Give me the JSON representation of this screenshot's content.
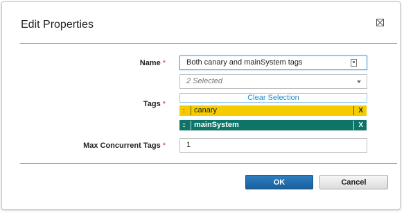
{
  "dialog": {
    "title": "Edit Properties",
    "close_icon": "close-icon"
  },
  "form": {
    "required_marker": "*",
    "name": {
      "label": "Name",
      "value": "Both canary and mainSystem tags",
      "icon": "field-picker-icon"
    },
    "tags": {
      "label": "Tags",
      "select_value": "2 Selected",
      "clear_label": "Clear Selection",
      "handle_glyph": "::",
      "remove_glyph": "X",
      "items": [
        {
          "label": "canary",
          "color": "#f5cc00"
        },
        {
          "label": "mainSystem",
          "color": "#0e7468"
        }
      ]
    },
    "max_concurrent": {
      "label": "Max Concurrent Tags",
      "value": "1"
    }
  },
  "buttons": {
    "ok": "OK",
    "cancel": "Cancel"
  },
  "colors": {
    "primary_button": "#1b5f9d",
    "required": "#d22b2b",
    "link": "#1b8dd0"
  }
}
